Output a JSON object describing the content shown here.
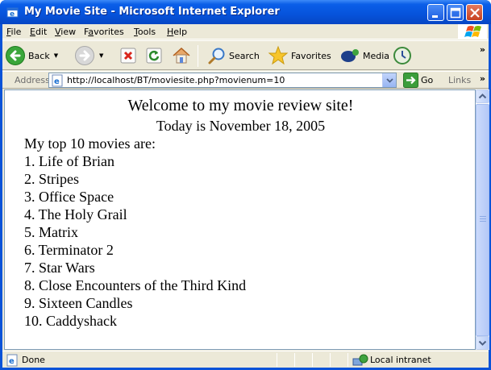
{
  "window": {
    "title": "My Movie Site - Microsoft Internet Explorer"
  },
  "menu": [
    {
      "label": "File",
      "accel": "F",
      "rest": "ile"
    },
    {
      "label": "Edit",
      "accel": "E",
      "rest": "dit"
    },
    {
      "label": "View",
      "accel": "V",
      "rest": "iew"
    },
    {
      "label": "Favorites",
      "accel": "a",
      "pre": "F",
      "rest": "vorites"
    },
    {
      "label": "Tools",
      "accel": "T",
      "rest": "ools"
    },
    {
      "label": "Help",
      "accel": "H",
      "rest": "elp"
    }
  ],
  "toolbar": {
    "back_label": "Back",
    "search_label": "Search",
    "favorites_label": "Favorites",
    "media_label": "Media"
  },
  "address": {
    "label": "Address",
    "url": "http://localhost/BT/moviesite.php?movienum=10",
    "go_label": "Go",
    "links_label": "Links"
  },
  "page": {
    "welcome": "Welcome to my movie review site!",
    "today": "Today is November 18, 2005",
    "list_heading": "My top 10 movies are:",
    "movies": [
      "1. Life of Brian",
      "2. Stripes",
      "3. Office Space",
      "4. The Holy Grail",
      "5. Matrix",
      "6. Terminator 2",
      "7. Star Wars",
      "8. Close Encounters of the Third Kind",
      "9. Sixteen Candles",
      "10. Caddyshack"
    ]
  },
  "status": {
    "text": "Done",
    "zone": "Local intranet"
  },
  "colors": {
    "titlebar": "#0653db",
    "chrome": "#ece9d8"
  }
}
